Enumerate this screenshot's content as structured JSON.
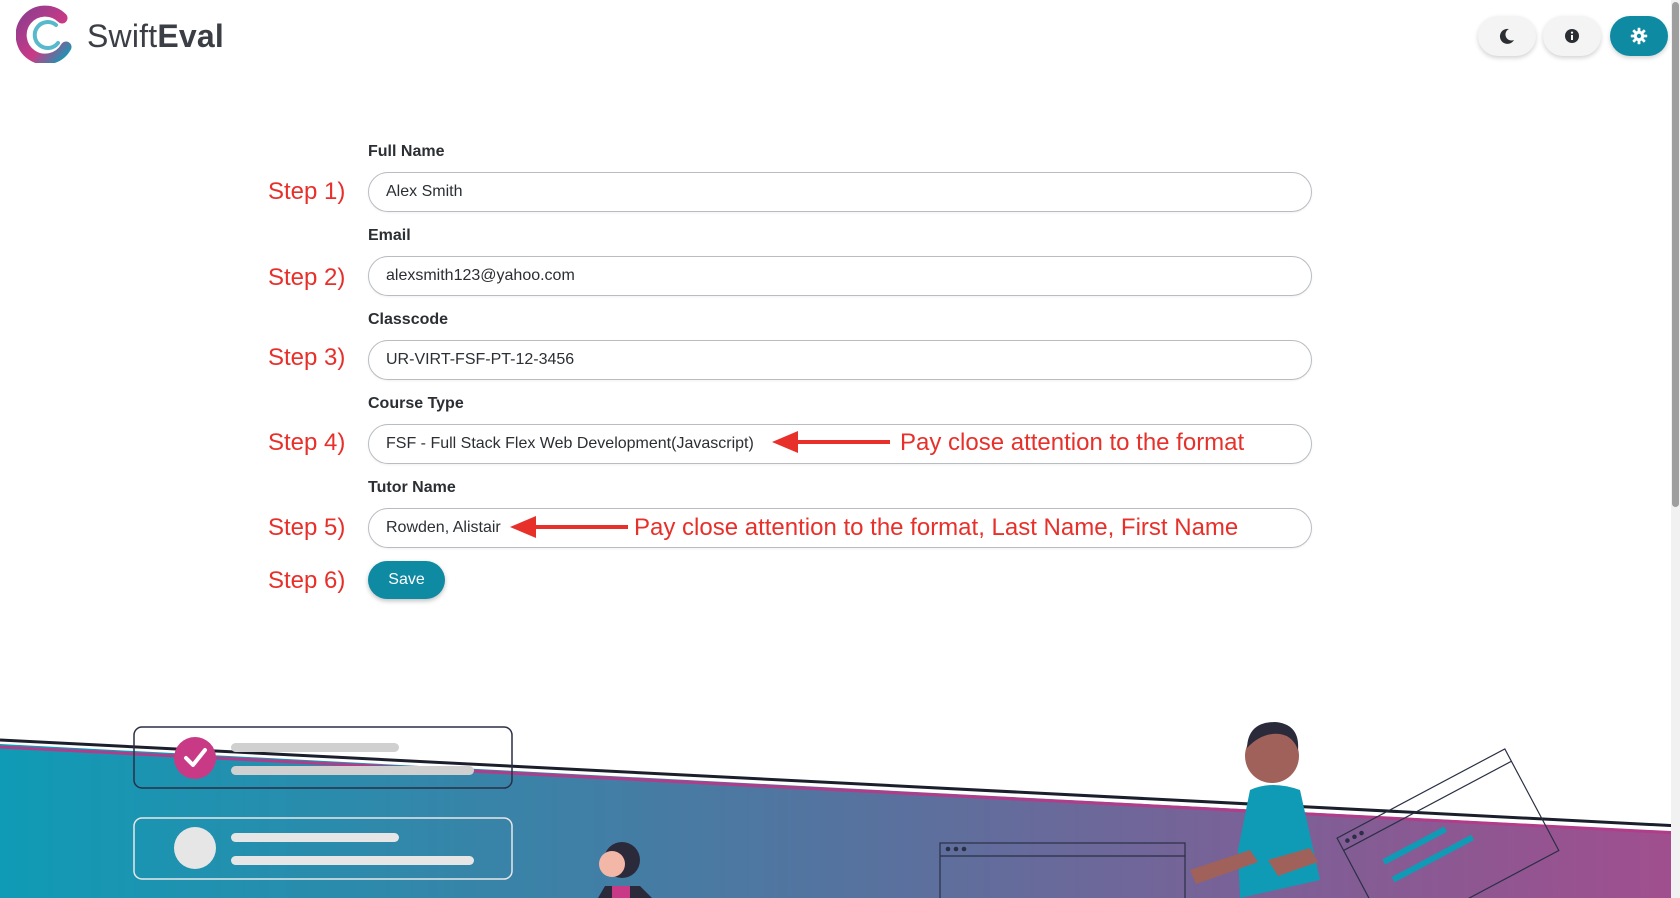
{
  "header": {
    "brand_light": "Swift",
    "brand_bold": "Eval",
    "buttons": [
      "moon-icon",
      "info-icon",
      "gear-icon"
    ],
    "accent_color": "#0f8aa3"
  },
  "form": {
    "full_name": {
      "label": "Full Name",
      "value": "Alex Smith"
    },
    "email": {
      "label": "Email",
      "value": "alexsmith123@yahoo.com"
    },
    "classcode": {
      "label": "Classcode",
      "value": "UR-VIRT-FSF-PT-12-3456"
    },
    "course_type": {
      "label": "Course Type",
      "value": "FSF - Full Stack Flex Web Development(Javascript)"
    },
    "tutor_name": {
      "label": "Tutor Name",
      "value": "Rowden, Alistair"
    },
    "save_label": "Save"
  },
  "annotations": {
    "steps": [
      "Step 1)",
      "Step 2)",
      "Step 3)",
      "Step 4)",
      "Step 5)",
      "Step 6)"
    ],
    "course_note": "Pay close attention to the format",
    "tutor_note": "Pay close attention to the format, Last Name, First Name",
    "color": "#e8302b"
  }
}
